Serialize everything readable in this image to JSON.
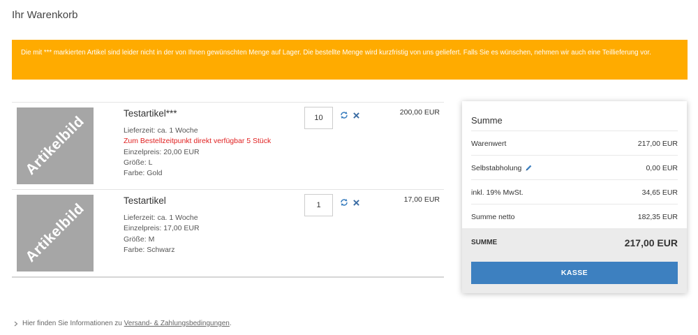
{
  "page": {
    "title": "Ihr Warenkorb"
  },
  "alert": {
    "text": "Die mit *** markierten Artikel sind leider nicht in der von Ihnen gewünschten Menge auf Lager. Die bestellte Menge wird kurzfristig von uns geliefert. Falls Sie es wünschen, nehmen wir auch eine Teillieferung vor.",
    "color": "#ffab00"
  },
  "items": [
    {
      "image_text": "Artikelbild",
      "name": "Testartikel***",
      "delivery": "Lieferzeit: ca. 1 Woche",
      "stock_warning": "Zum Bestellzeitpunkt direkt verfügbar 5 Stück",
      "unit_price": "Einzelpreis: 20,00 EUR",
      "size": "Größe: L",
      "color": "Farbe: Gold",
      "quantity": "10",
      "price": "200,00 EUR"
    },
    {
      "image_text": "Artikelbild",
      "name": "Testartikel",
      "delivery": "Lieferzeit: ca. 1 Woche",
      "unit_price": "Einzelpreis: 17,00 EUR",
      "size": "Größe: M",
      "color": "Farbe: Schwarz",
      "quantity": "1",
      "price": "17,00 EUR"
    }
  ],
  "summary": {
    "title": "Summe",
    "rows": [
      {
        "label": "Warenwert",
        "value": "217,00 EUR"
      },
      {
        "label": "Selbstabholung",
        "value": "0,00 EUR",
        "icon": "pencil-icon"
      },
      {
        "label": "inkl. 19% MwSt.",
        "value": "34,65 EUR"
      },
      {
        "label": "Summe netto",
        "value": "182,35 EUR"
      }
    ],
    "total_label": "SUMME",
    "total_value": "217,00 EUR",
    "checkout_label": "KASSE",
    "accent": "#3d80c0"
  },
  "footer": {
    "info_prefix": "Hier finden Sie Informationen zu",
    "info_link": "Versand- & Zahlungsbedingungen",
    "info_suffix": "."
  }
}
